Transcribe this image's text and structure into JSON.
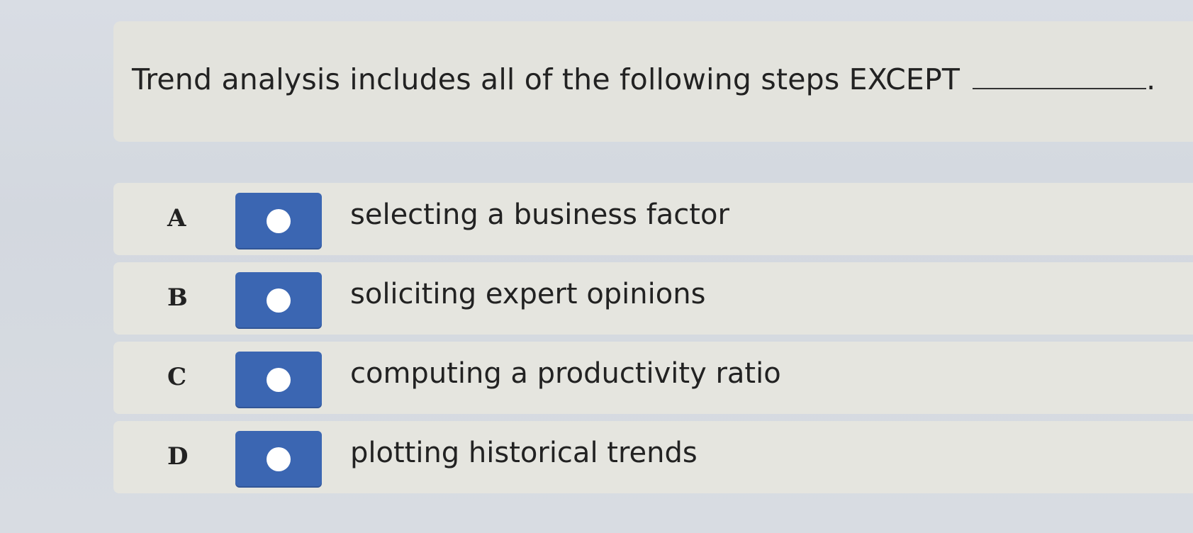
{
  "question": {
    "text": "Trend analysis includes all of the following steps EXCEPT",
    "trailing_punctuation": "."
  },
  "answers": [
    {
      "letter": "A",
      "text": "selecting a business factor",
      "radio_icon": "radio-button-icon"
    },
    {
      "letter": "B",
      "text": "soliciting expert opinions",
      "radio_icon": "radio-button-icon"
    },
    {
      "letter": "C",
      "text": "computing a productivity ratio",
      "radio_icon": "radio-button-icon"
    },
    {
      "letter": "D",
      "text": "plotting historical trends",
      "radio_icon": "radio-button-icon"
    }
  ],
  "colors": {
    "radio_button": "#3b66b2",
    "card_background": "#e3e3dd",
    "page_background": "#d6dae1"
  }
}
